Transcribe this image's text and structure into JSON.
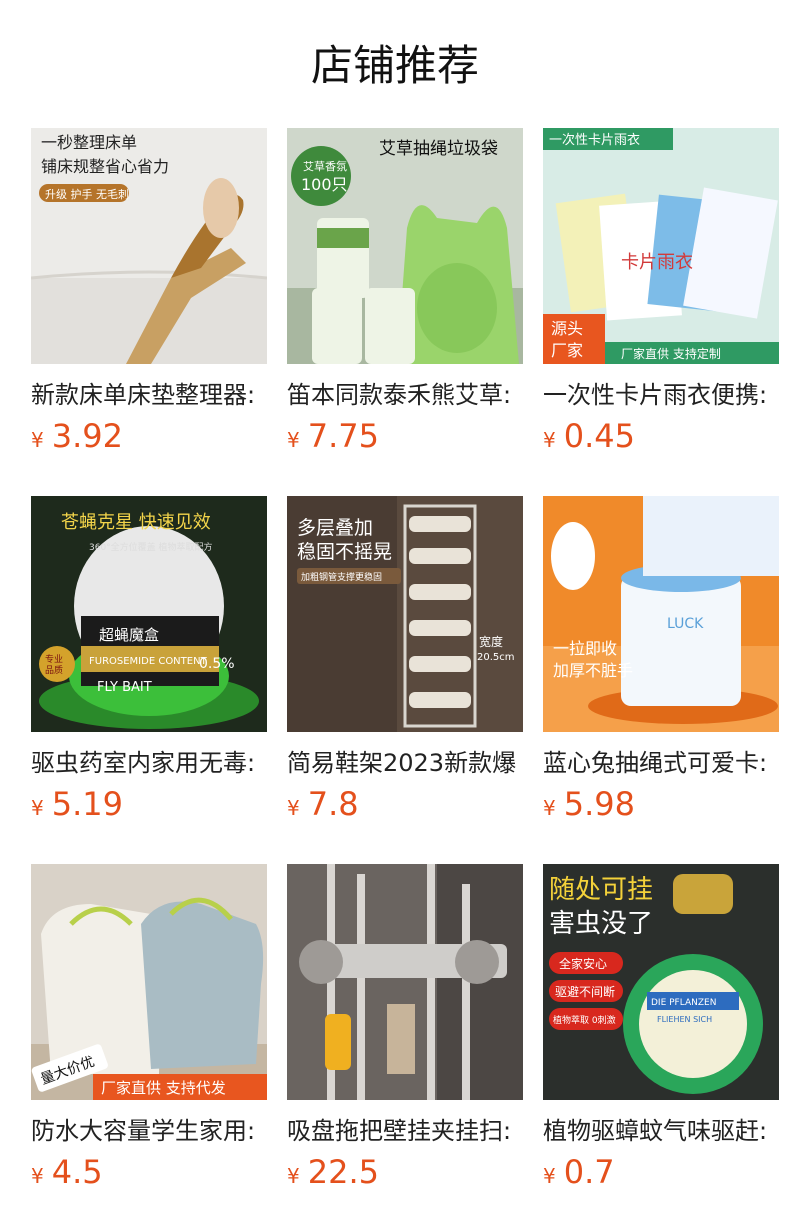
{
  "page": {
    "title": "店铺推荐"
  },
  "currency_symbol": "¥",
  "products": [
    {
      "name": "新款床单床垫整理器:",
      "price": "3.92",
      "image_text": [
        "一秒整理床单",
        "铺床规整省心省力",
        "升级 护手 无毛刺"
      ]
    },
    {
      "name": "笛本同款泰禾熊艾草:",
      "price": "7.75",
      "image_text": [
        "艾草抽绳垃圾袋",
        "艾草香氛",
        "100只"
      ]
    },
    {
      "name": "一次性卡片雨衣便携:",
      "price": "0.45",
      "image_text": [
        "一次性卡片雨衣",
        "源头",
        "厂家",
        "厂家直供 支持定制",
        "卡片雨衣"
      ]
    },
    {
      "name": "驱虫药室内家用无毒:",
      "price": "5.19",
      "image_text": [
        "苍蝇克星 快速见效",
        "360°全方位覆盖 植物萃取配方",
        "超蝇魔盒",
        "FUROSEMIDE CONTENT",
        "0.5%",
        "FLY BAIT",
        "专业",
        "品质"
      ]
    },
    {
      "name": "简易鞋架2023新款爆",
      "price": "7.8",
      "image_text": [
        "多层叠加",
        "稳固不摇晃",
        "加粗钢管支撑更稳固",
        "宽度",
        "20.5cm"
      ]
    },
    {
      "name": "蓝心兔抽绳式可爱卡:",
      "price": "5.98",
      "image_text": [
        "一拉即收",
        "加厚不脏手",
        "LUCK"
      ]
    },
    {
      "name": "防水大容量学生家用:",
      "price": "4.5",
      "image_text": [
        "量大价优",
        "厂家直供 支持代发"
      ]
    },
    {
      "name": "吸盘拖把壁挂夹挂扫:",
      "price": "22.5",
      "image_text": []
    },
    {
      "name": "植物驱蟑蚊气味驱赶:",
      "price": "0.7",
      "image_text": [
        "随处可挂",
        "害虫没了",
        "全家安心",
        "驱避不间断",
        "植物萃取 0刺激",
        "DIE PFLANZEN",
        "FLIEHEN SICH"
      ]
    }
  ],
  "colors": {
    "price": "#e4501c",
    "title": "#111111",
    "name": "#222222"
  }
}
